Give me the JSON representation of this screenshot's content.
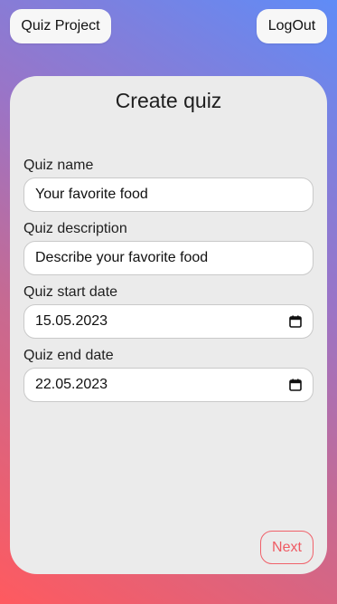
{
  "header": {
    "brand_label": "Quiz Project",
    "logout_label": "LogOut"
  },
  "card": {
    "title": "Create quiz",
    "fields": [
      {
        "label": "Quiz name",
        "value": "Your favorite food",
        "icon": ""
      },
      {
        "label": "Quiz description",
        "value": "Describe your favorite food",
        "icon": ""
      },
      {
        "label": "Quiz start date",
        "value": "15.05.2023",
        "icon": "calendar-icon"
      },
      {
        "label": "Quiz end date",
        "value": "22.05.2023",
        "icon": "calendar-icon"
      }
    ],
    "next_label": "Next"
  },
  "colors": {
    "accent": "#ef5a63",
    "gradient_start": "#ff5a5f",
    "gradient_end": "#5f8cf7",
    "card_bg": "#ebebeb"
  }
}
